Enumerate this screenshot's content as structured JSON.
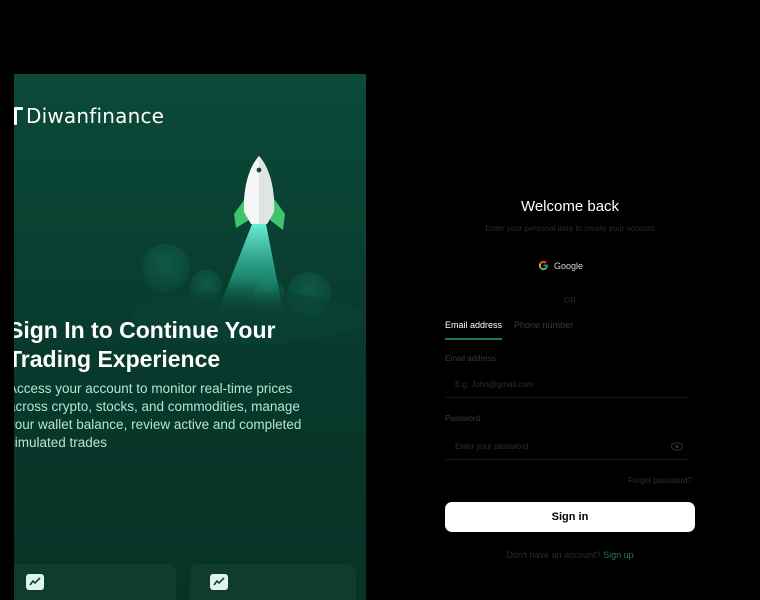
{
  "brand": {
    "name": "Diwanfinance"
  },
  "hero": {
    "title": "Sign In to Continue Your Trading Experience",
    "description": "Access your account to monitor real-time prices across crypto, stocks, and commodities, manage your wallet balance, review active and completed simulated trades"
  },
  "form": {
    "title": "Welcome back",
    "subtitle": "Enter your personal data to create your account",
    "google_label": "Google",
    "or_label": "OR",
    "tabs": [
      {
        "label": "Email address",
        "active": true
      },
      {
        "label": "Phone number",
        "active": false
      }
    ],
    "email": {
      "label": "Email address",
      "placeholder": "E.g. John@gmail.com",
      "value": ""
    },
    "password": {
      "label": "Password",
      "placeholder": "Enter your password",
      "value": ""
    },
    "forgot_label": "Forgot password?",
    "signin_label": "Sign in",
    "signup_prompt": "Don't have an account?",
    "signup_link": "Sign up"
  },
  "colors": {
    "panel_bg": "#0b4a38",
    "accent_green": "#1f7a5c",
    "rocket_green": "#3ec46d",
    "flame": "#4df0d0"
  },
  "icons": {
    "brand": "brand-logo-icon",
    "google": "google-icon",
    "eye": "eye-icon",
    "chart": "trend-chart-icon"
  }
}
